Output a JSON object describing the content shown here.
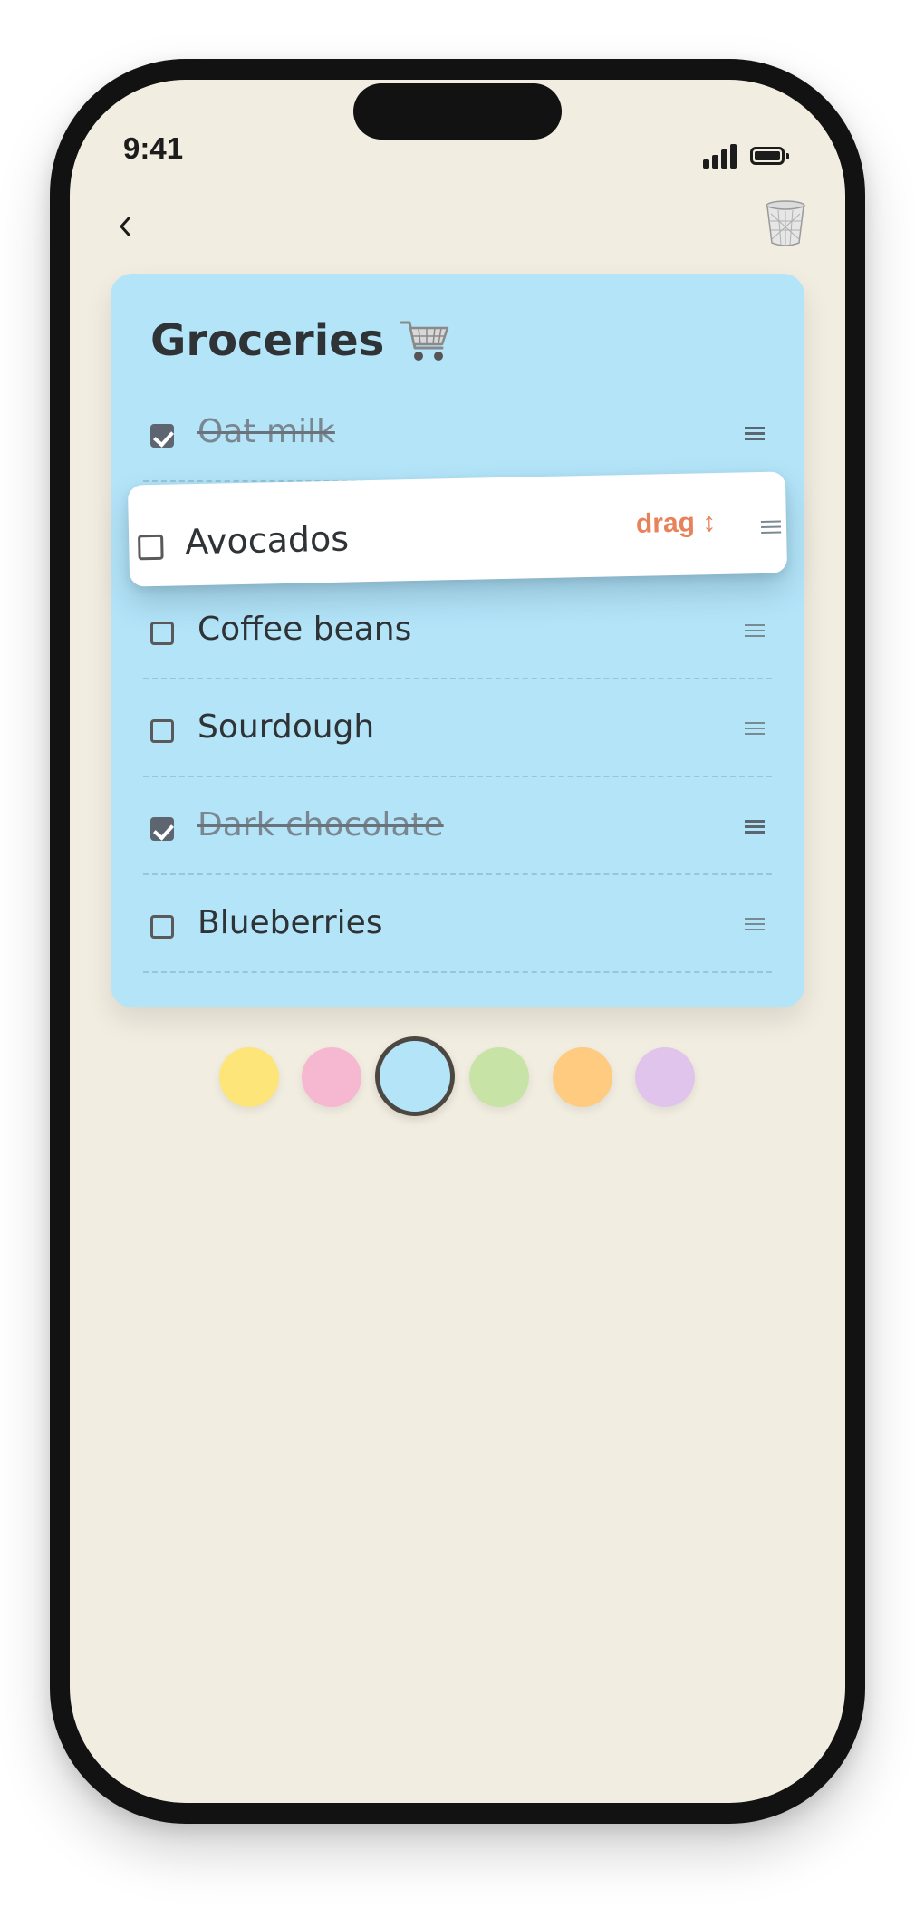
{
  "status_bar": {
    "time": "9:41"
  },
  "nav": {
    "back_icon": "chevron-left-icon",
    "delete_icon": "trash-bin-icon"
  },
  "note": {
    "title": "Groceries",
    "title_icon": "shopping-cart-icon",
    "background_color": "#b3e4f8",
    "items": [
      {
        "label": "Oat milk",
        "checked": true
      },
      {
        "label": "Coffee beans",
        "checked": false
      },
      {
        "label": "Sourdough",
        "checked": false
      },
      {
        "label": "Dark chocolate",
        "checked": true
      },
      {
        "label": "Blueberries",
        "checked": false
      }
    ],
    "dragging_item": {
      "label": "Avocados",
      "checked": false,
      "hint": "drag ↕"
    }
  },
  "color_picker": {
    "selected_index": 2,
    "swatches": [
      {
        "name": "yellow",
        "color": "#fde57a"
      },
      {
        "name": "pink",
        "color": "#f6b8d1"
      },
      {
        "name": "blue",
        "color": "#b3e4f8"
      },
      {
        "name": "green",
        "color": "#c7e3a6"
      },
      {
        "name": "orange",
        "color": "#fecb80"
      },
      {
        "name": "lavender",
        "color": "#e0c4ec"
      }
    ]
  },
  "colors": {
    "background": "#f2ede1",
    "accent": "#e8825a",
    "text": "#2f3336"
  }
}
